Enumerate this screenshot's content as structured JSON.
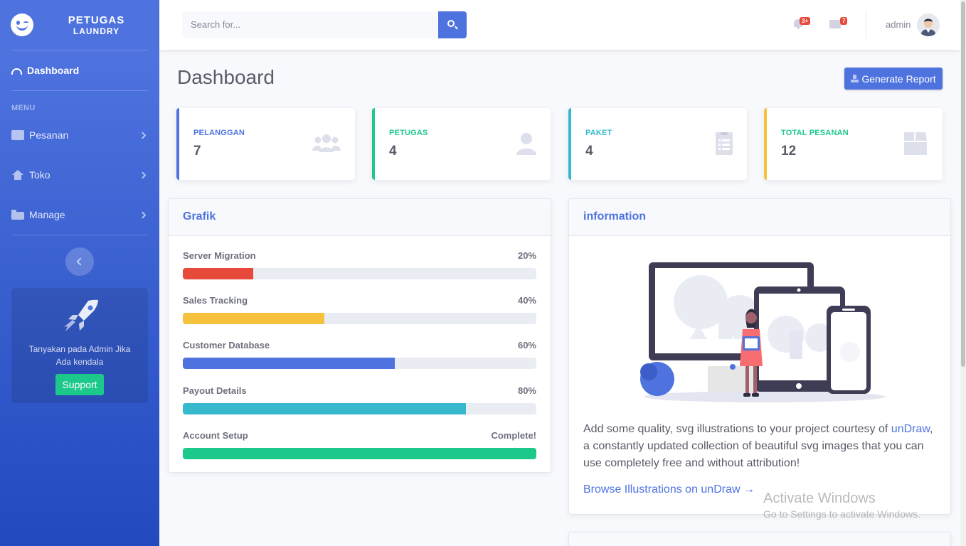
{
  "brand": {
    "line1": "PETUGAS",
    "line2": "LAUNDRY"
  },
  "sidebar": {
    "dashboard_label": "Dashboard",
    "menu_heading": "MENU",
    "items": [
      {
        "label": "Pesanan",
        "icon": "calendar-icon"
      },
      {
        "label": "Toko",
        "icon": "home-icon"
      },
      {
        "label": "Manage",
        "icon": "folder-icon"
      }
    ],
    "promo": {
      "text": "Tanyakan pada Admin Jika Ada kendala",
      "button": "Support"
    }
  },
  "topbar": {
    "search_placeholder": "Search for...",
    "alerts_count": "3+",
    "messages_count": "7",
    "username": "admin"
  },
  "page": {
    "title": "Dashboard",
    "report_button": "Generate Report"
  },
  "stats": [
    {
      "label": "PELANGGAN",
      "value": "7",
      "color": "#4e73df",
      "icon": "users-icon"
    },
    {
      "label": "PETUGAS",
      "value": "4",
      "color": "#1cc88a",
      "icon": "user-icon"
    },
    {
      "label": "PAKET",
      "value": "4",
      "color": "#36b9cc",
      "icon": "clipboard-list-icon"
    },
    {
      "label": "TOTAL PESANAN",
      "value": "12",
      "color": "#f6c23e",
      "icon": "box-icon"
    }
  ],
  "grafik": {
    "title": "Grafik",
    "rows": [
      {
        "label": "Server Migration",
        "value_text": "20%",
        "fraction": 0.2,
        "color": "#e74a3b"
      },
      {
        "label": "Sales Tracking",
        "value_text": "40%",
        "fraction": 0.4,
        "color": "#f6c23e"
      },
      {
        "label": "Customer Database",
        "value_text": "60%",
        "fraction": 0.6,
        "color": "#4e73df"
      },
      {
        "label": "Payout Details",
        "value_text": "80%",
        "fraction": 0.8,
        "color": "#36b9cc"
      },
      {
        "label": "Account Setup",
        "value_text": "Complete!",
        "fraction": 1.0,
        "color": "#1cc88a"
      }
    ]
  },
  "information": {
    "title": "information",
    "text_before": "Add some quality, svg illustrations to your project courtesy of ",
    "link": "unDraw",
    "text_after": ", a constantly updated collection of beautiful svg images that you can use completely free and without attribution!",
    "browse_link": "Browse Illustrations on unDraw →"
  },
  "watermark": {
    "title": "Activate Windows",
    "subtitle": "Go to Settings to activate Windows."
  }
}
